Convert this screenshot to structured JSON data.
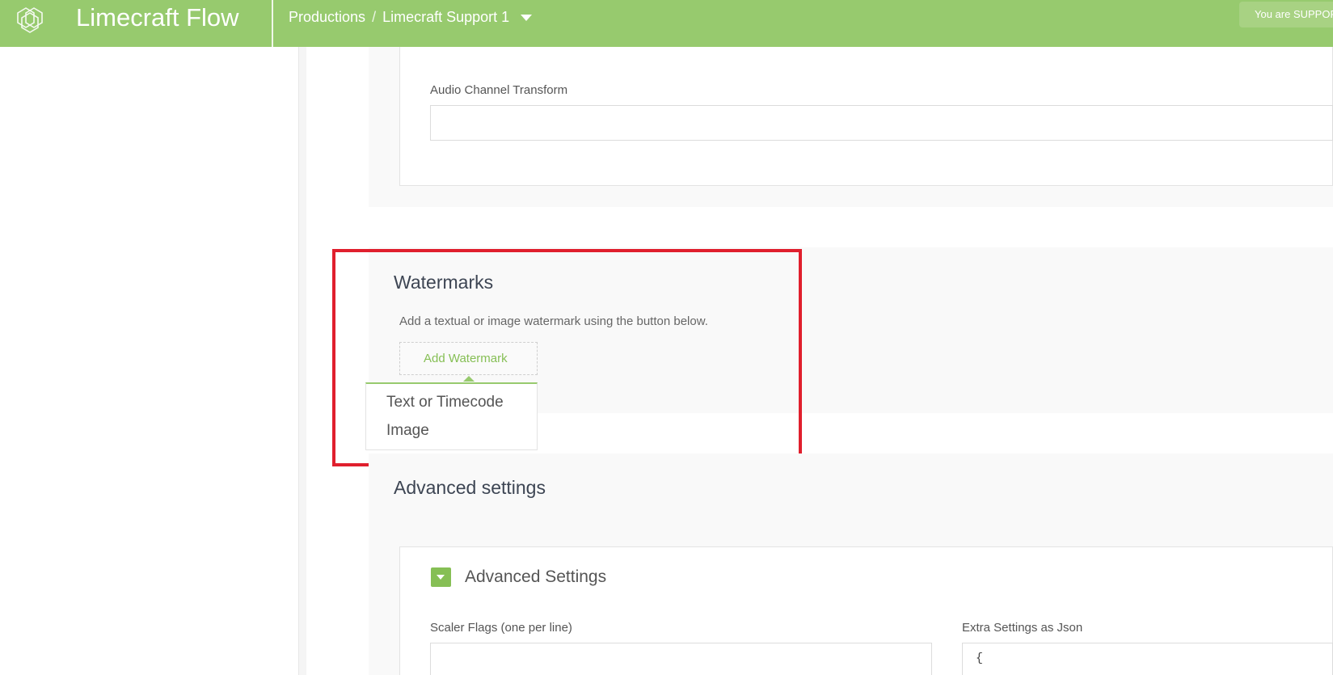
{
  "header": {
    "app_title": "Limecraft Flow",
    "breadcrumb_root": "Productions",
    "breadcrumb_separator": "/",
    "breadcrumb_current": "Limecraft Support 1",
    "user_badge": "You are SUPPORT"
  },
  "audio": {
    "label": "Audio Channel Transform",
    "value": ""
  },
  "watermarks": {
    "title": "Watermarks",
    "description": "Add a textual or image watermark using the button below.",
    "add_button_label": "Add Watermark",
    "menu_items": [
      "Text or Timecode",
      "Image"
    ]
  },
  "advanced": {
    "section_title": "Advanced settings",
    "card_title": "Advanced Settings",
    "scaler_flags_label": "Scaler Flags (one per line)",
    "scaler_flags_value": "",
    "extra_settings_label": "Extra Settings as Json",
    "extra_settings_value": "{"
  },
  "colors": {
    "brand": "#97ca6e",
    "accent": "#86bf55",
    "highlight": "#e01f2d"
  }
}
